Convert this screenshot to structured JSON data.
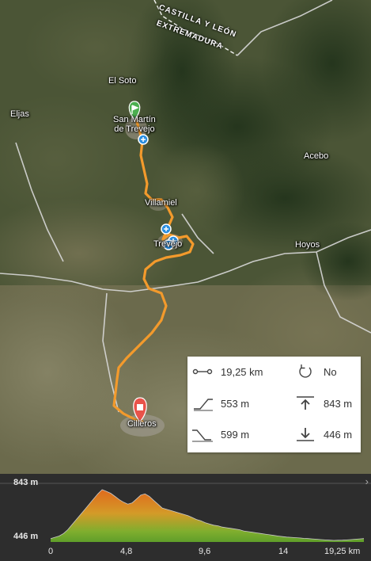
{
  "map": {
    "region_labels": [
      "CASTILLA Y LEÓN",
      "EXTREMADURA"
    ],
    "places": {
      "el_soto": "El Soto",
      "eljas": "Eljas",
      "san_martin_line1": "San Martín",
      "san_martin_line2": "de Trevejo",
      "acebo": "Acebo",
      "villamiel": "Villamiel",
      "trevejo": "Trevejo",
      "hoyos": "Hoyos",
      "cilleros": "Cilleros"
    },
    "colors": {
      "route": "#f39a2c",
      "start_marker": "#4caf50",
      "end_marker": "#e8534a",
      "waypoint": "#2a8ee0",
      "roads": "#d8d8d8"
    }
  },
  "stats": {
    "distance": "19,25 km",
    "loop": "No",
    "ascent": "553 m",
    "max_elevation": "843 m",
    "descent": "599 m",
    "min_elevation": "446 m",
    "icons": [
      "distance-icon",
      "loop-icon",
      "ascent-icon",
      "max-elevation-icon",
      "descent-icon",
      "min-elevation-icon"
    ]
  },
  "profile": {
    "max_label": "843 m",
    "min_label": "446 m",
    "ticks": [
      "0",
      "4,8",
      "9,6",
      "14",
      "19,25 km"
    ],
    "expand_icon": "chevron-right-icon",
    "elevation_values": [
      460,
      470,
      480,
      500,
      530,
      570,
      610,
      650,
      690,
      730,
      770,
      810,
      843,
      830,
      815,
      790,
      765,
      745,
      730,
      740,
      770,
      800,
      810,
      790,
      760,
      730,
      700,
      690,
      680,
      670,
      660,
      650,
      640,
      625,
      610,
      600,
      585,
      575,
      565,
      560,
      550,
      545,
      540,
      535,
      530,
      520,
      515,
      510,
      505,
      500,
      495,
      490,
      485,
      480,
      476,
      472,
      470,
      468,
      465,
      462,
      460,
      458,
      455,
      452,
      450,
      448,
      446,
      447,
      448,
      450,
      452,
      455,
      458,
      460
    ]
  }
}
